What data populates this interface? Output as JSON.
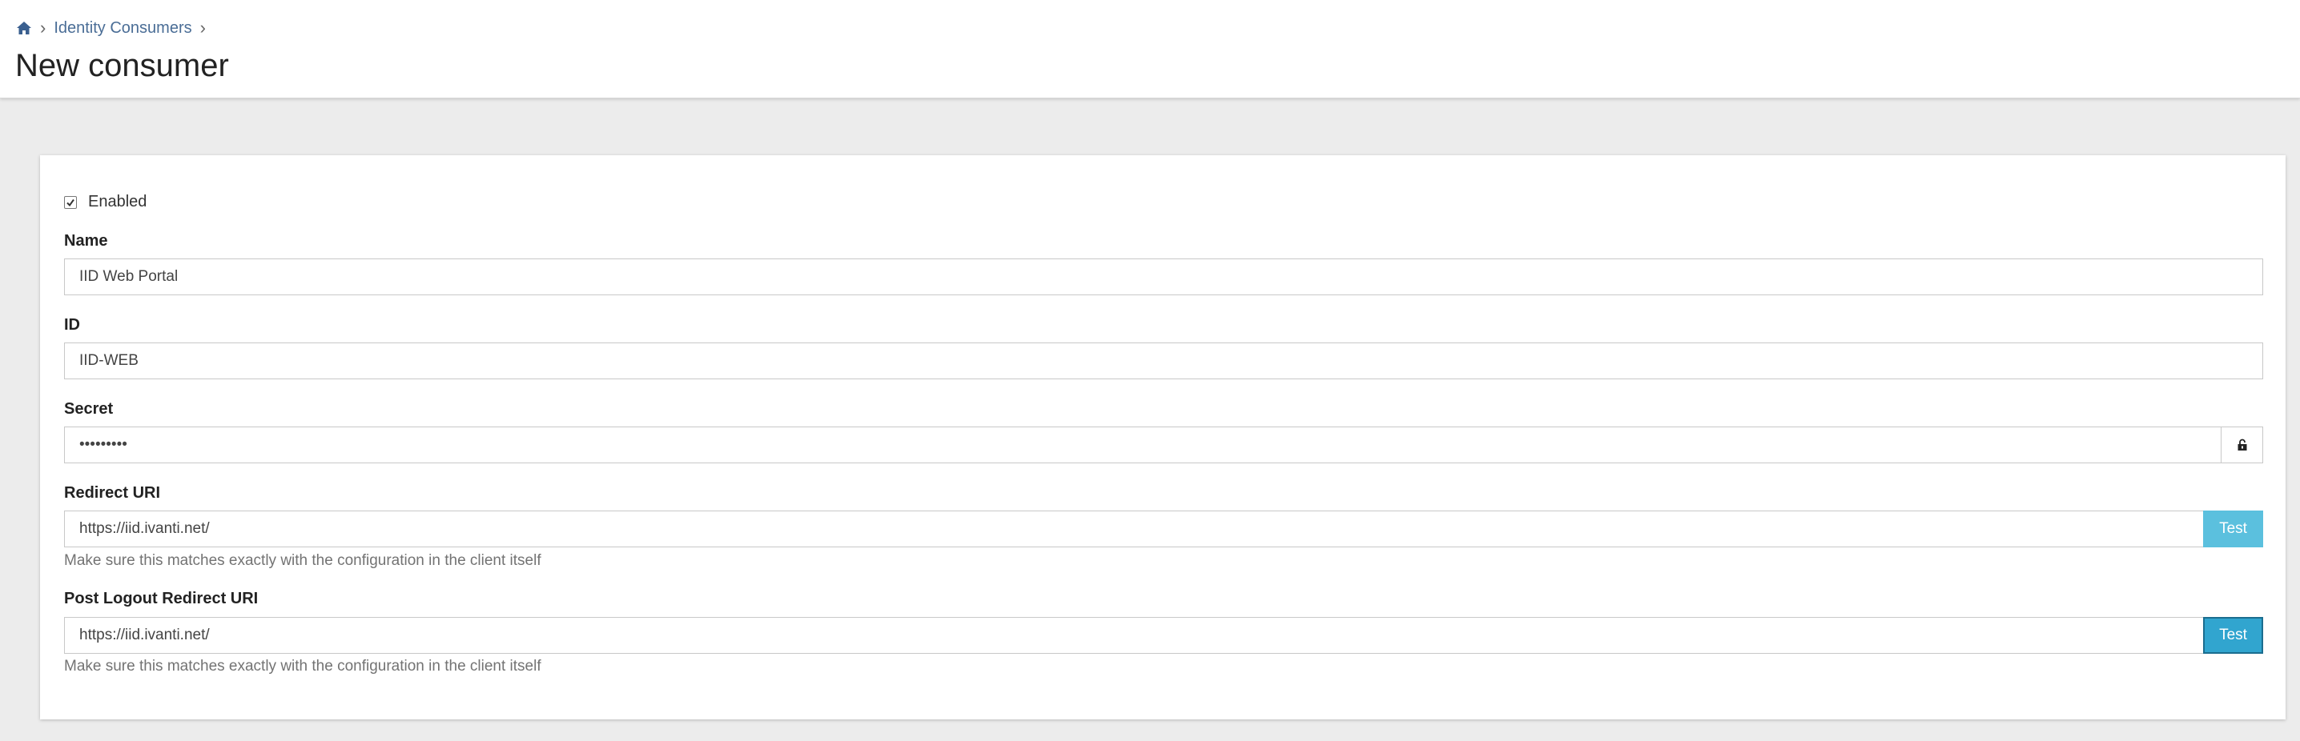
{
  "breadcrumb": {
    "home_icon": "home-icon",
    "items": [
      "Identity Consumers"
    ],
    "separator_icon": "chevron-right-icon"
  },
  "page": {
    "title": "New consumer"
  },
  "form": {
    "enabled": {
      "label": "Enabled",
      "checked": true
    },
    "name": {
      "label": "Name",
      "value": "IID Web Portal"
    },
    "id": {
      "label": "ID",
      "value": "IID-WEB"
    },
    "secret": {
      "label": "Secret",
      "value": "•••••••••",
      "toggle_icon": "unlock-icon"
    },
    "redirect_uri": {
      "label": "Redirect URI",
      "value": "https://iid.ivanti.net/",
      "button": "Test",
      "help": "Make sure this matches exactly with the configuration in the client itself"
    },
    "post_logout_redirect_uri": {
      "label": "Post Logout Redirect URI",
      "value": "https://iid.ivanti.net/",
      "button": "Test",
      "help": "Make sure this matches exactly with the configuration in the client itself"
    }
  },
  "colors": {
    "link": "#4a6d96",
    "test_button": "#5bc0de",
    "test_button_active": "#31a5cf",
    "background": "#ececec"
  }
}
